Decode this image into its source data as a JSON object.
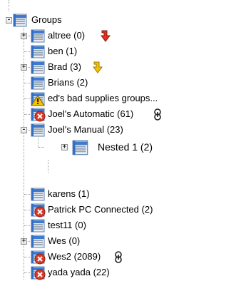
{
  "colors": {
    "connector": "#a0a0a0",
    "folder_blue": "#2f6fc8",
    "error_red": "#d83a2a",
    "warning_yellow": "#f2c300",
    "arrow_red": "#e0301e",
    "arrow_yellow": "#f4c20d"
  },
  "tree": {
    "root": {
      "label": "Groups",
      "icon": "group-folder-icon",
      "expander": "-"
    },
    "items": [
      {
        "label": "altree (0)",
        "icon": "group-folder-icon",
        "expander": "+",
        "badge": "red-down-arrow-icon"
      },
      {
        "label": "ben (1)",
        "icon": "group-folder-icon"
      },
      {
        "label": "Brad (3)",
        "icon": "group-folder-icon",
        "expander": "+",
        "badge": "yellow-down-arrow-icon"
      },
      {
        "label": "Brians (2)",
        "icon": "group-folder-icon"
      },
      {
        "label": "ed's bad supplies groups...",
        "icon": "group-warning-icon"
      },
      {
        "label": "Joel's Automatic (61)",
        "icon": "group-error-icon",
        "badge": "link-chain-icon"
      },
      {
        "label": "Joel's Manual (23)",
        "icon": "group-folder-icon",
        "expander": "-"
      },
      {
        "label": "Nested 1 (2)",
        "icon": "group-folder-icon",
        "expander": "+"
      },
      {
        "label": "karens (1)",
        "icon": "group-folder-icon"
      },
      {
        "label": "Patrick PC Connected (2)",
        "icon": "group-error-icon"
      },
      {
        "label": "test11 (0)",
        "icon": "group-folder-icon"
      },
      {
        "label": "Wes (0)",
        "icon": "group-folder-icon",
        "expander": "+"
      },
      {
        "label": "Wes2 (2089)",
        "icon": "group-error-icon",
        "badge": "link-chain-icon"
      },
      {
        "label": "yada yada (22)",
        "icon": "group-error-icon"
      }
    ]
  }
}
